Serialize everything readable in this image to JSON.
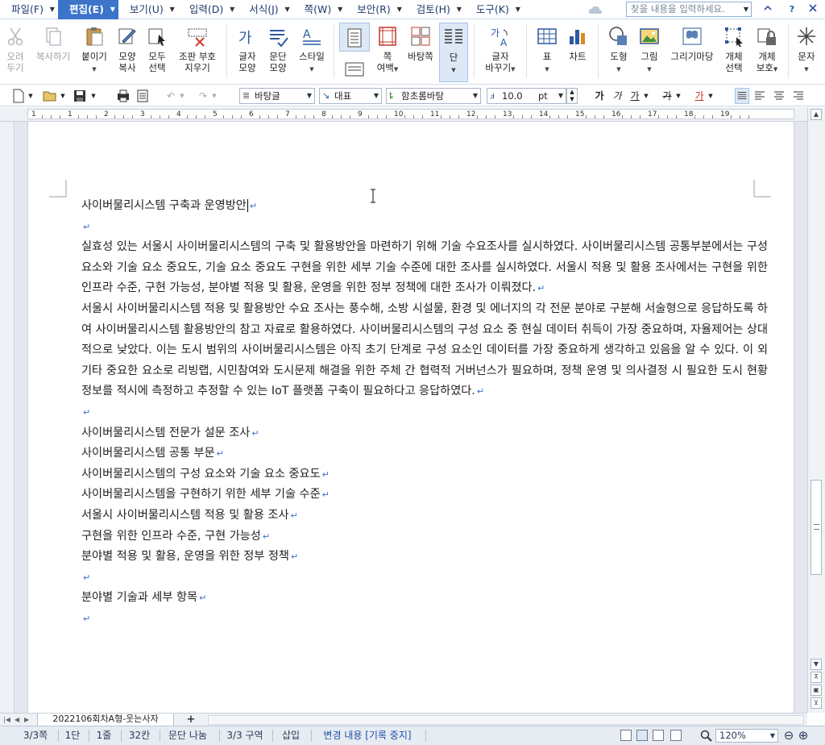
{
  "menubar": {
    "items": [
      {
        "label": "파일(F)"
      },
      {
        "label": "편집(E)"
      },
      {
        "label": "보기(U)"
      },
      {
        "label": "입력(D)"
      },
      {
        "label": "서식(J)"
      },
      {
        "label": "쪽(W)"
      },
      {
        "label": "보안(R)"
      },
      {
        "label": "검토(H)"
      },
      {
        "label": "도구(K)"
      }
    ],
    "search_placeholder": "찾을 내용을 입력하세요.",
    "help_label": "?",
    "collapse_label": "^",
    "close_label": "X"
  },
  "ribbon": {
    "undo": "오려\n두기",
    "cut_label": "오려\n두기",
    "copy_label": "복사하기",
    "paste_label": "붙이기",
    "format_copy_label": "모양\n복사",
    "select_all_label": "모두\n선택",
    "clear_label": "조판 부호\n지우기",
    "char_shape_label": "글자\n모양",
    "para_shape_label": "문단\n모양",
    "style_label": "스타일",
    "page_margin_label": "쪽\n여백",
    "background_label": "바탕쪽",
    "columns_label": "단",
    "char_convert_label": "글자\n바꾸기",
    "table_label": "표",
    "chart_label": "차트",
    "shape_label": "도형",
    "picture_label": "그림",
    "drawing_market_label": "그리기마당",
    "object_select_label": "개체\n선택",
    "object_protect_label": "개체\n보호",
    "symbol_label": "문자"
  },
  "toolbar2": {
    "style_value": "바탕글",
    "lang_value": "대표",
    "font_value": "함초롬바탕",
    "size_value": "10.0",
    "size_unit": "pt",
    "bold_glyph": "가",
    "italic_glyph": "가",
    "underline_glyph": "가",
    "strike_glyph": "가",
    "color_glyph": "가"
  },
  "ruler": {
    "labels": [
      "1",
      "1",
      "2",
      "3",
      "4",
      "5",
      "6",
      "7",
      "8",
      "9",
      "10",
      "11",
      "12",
      "13",
      "14",
      "15",
      "16",
      "17",
      "18",
      "19"
    ]
  },
  "document": {
    "title": "사이버물리시스템 구축과 운영방안",
    "paragraph1": "실효성 있는 서울시 사이버물리시스템의 구축 및 활용방안을 마련하기 위해 기술 수요조사를 실시하였다. 사이버물리시스템 공통부분에서는 구성 요소와 기술 요소 중요도, 기술 요소 중요도 구현을 위한 세부 기술 수준에 대한 조사를 실시하였다. 서울시 적용 및 활용 조사에서는 구현을 위한 인프라 수준, 구현 가능성, 분야별 적용 및 활용, 운영을 위한 정부 정책에 대한 조사가 이뤄졌다.",
    "paragraph2": "서울시 사이버물리시스템 적용 및 활용방안 수요 조사는 풍수해, 소방 시설물, 환경 및 에너지의 각 전문 분야로 구분해 서술형으로 응답하도록 하여 사이버물리시스템 활용방안의 참고 자료로 활용하였다. 사이버물리시스템의 구성 요소 중 현실 데이터 취득이 가장 중요하며, 자율제어는 상대적으로 낮았다. 이는 도시 범위의 사이버물리시스템은 아직 초기 단계로 구성 요소인 데이터를 가장 중요하게 생각하고 있음을 알 수 있다. 이 외 기타 중요한 요소로 리빙랩, 시민참여와 도시문제 해결을 위한 주체 간 협력적 거버넌스가 필요하며, 정책 운영 및 의사결정 시 필요한 도시 현황 정보를 적시에 측정하고 추정할 수 있는 IoT 플랫폼 구축이 필요하다고 응답하였다.",
    "lines": [
      "사이버물리시스템 전문가 설문 조사",
      "사이버물리시스템 공통 부문",
      "사이버물리시스템의 구성 요소와 기술 요소 중요도",
      "사이버물리시스템을 구현하기 위한 세부 기술 수준",
      "서울시 사이버물리시스템 적용 및 활용 조사",
      "구현을 위한 인프라 수준, 구현 가능성",
      "분야별 적용 및 활용, 운영을 위한 정부 정책"
    ],
    "last_line": "분야별 기술과 세부 항목",
    "paragraph_mark": "↵"
  },
  "tabs": {
    "sheet_name": "2022106회차A형-웃는사자",
    "add_label": "+"
  },
  "status": {
    "page": "3/3쪽",
    "column": "1단",
    "line": "1줄",
    "char": "32칸",
    "break": "문단 나눔",
    "section": "3/3 구역",
    "insert_mode": "삽입",
    "track_changes": "변경 내용 [기록 중지]",
    "zoom": "120%"
  },
  "colors": {
    "accent": "#3b74c9",
    "menu_text": "#1f3b6e",
    "para_mark": "#3a6fd0",
    "status_bg": "#e7ecf2"
  }
}
